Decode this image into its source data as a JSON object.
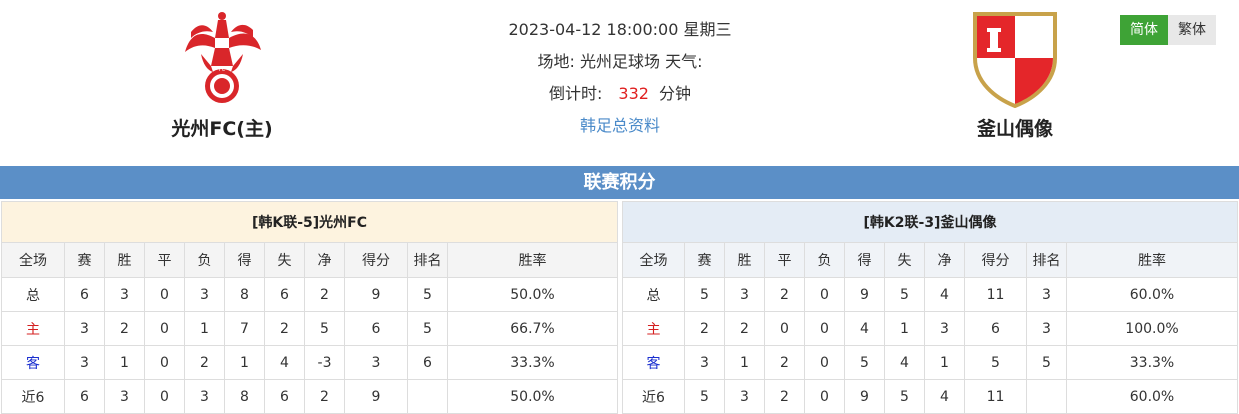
{
  "match": {
    "datetime": "2023-04-12 18:00:00 星期三",
    "venue_line": "场地: 光州足球场 天气:",
    "countdown_label": "倒计时:",
    "countdown_value": "332",
    "countdown_unit": "分钟",
    "league_link": "韩足总资料"
  },
  "home": {
    "name": "光州FC(主)",
    "logo_icon": "phoenix-crest-icon",
    "logo_color": "#d9262a"
  },
  "away": {
    "name": "釜山偶像",
    "logo_icon": "shield-crest-icon",
    "logo_color": "#e4262a"
  },
  "lang": {
    "simplified": "简体",
    "traditional": "繁体"
  },
  "section_title": "联赛积分",
  "tables": {
    "home": {
      "title": "[韩K联-5]光州FC",
      "headers": [
        "全场",
        "赛",
        "胜",
        "平",
        "负",
        "得",
        "失",
        "净",
        "得分",
        "排名",
        "胜率"
      ],
      "rows": [
        [
          "总",
          "6",
          "3",
          "0",
          "3",
          "8",
          "6",
          "2",
          "9",
          "5",
          "50.0%"
        ],
        [
          "主",
          "3",
          "2",
          "0",
          "1",
          "7",
          "2",
          "5",
          "6",
          "5",
          "66.7%"
        ],
        [
          "客",
          "3",
          "1",
          "0",
          "2",
          "1",
          "4",
          "-3",
          "3",
          "6",
          "33.3%"
        ],
        [
          "近6",
          "6",
          "3",
          "0",
          "3",
          "8",
          "6",
          "2",
          "9",
          "",
          "50.0%"
        ]
      ]
    },
    "away": {
      "title": "[韩K2联-3]釜山偶像",
      "headers": [
        "全场",
        "赛",
        "胜",
        "平",
        "负",
        "得",
        "失",
        "净",
        "得分",
        "排名",
        "胜率"
      ],
      "rows": [
        [
          "总",
          "5",
          "3",
          "2",
          "0",
          "9",
          "5",
          "4",
          "11",
          "3",
          "60.0%"
        ],
        [
          "主",
          "2",
          "2",
          "0",
          "0",
          "4",
          "1",
          "3",
          "6",
          "3",
          "100.0%"
        ],
        [
          "客",
          "3",
          "1",
          "2",
          "0",
          "5",
          "4",
          "1",
          "5",
          "5",
          "33.3%"
        ],
        [
          "近6",
          "5",
          "3",
          "2",
          "0",
          "9",
          "5",
          "4",
          "11",
          "",
          "60.0%"
        ]
      ]
    }
  }
}
